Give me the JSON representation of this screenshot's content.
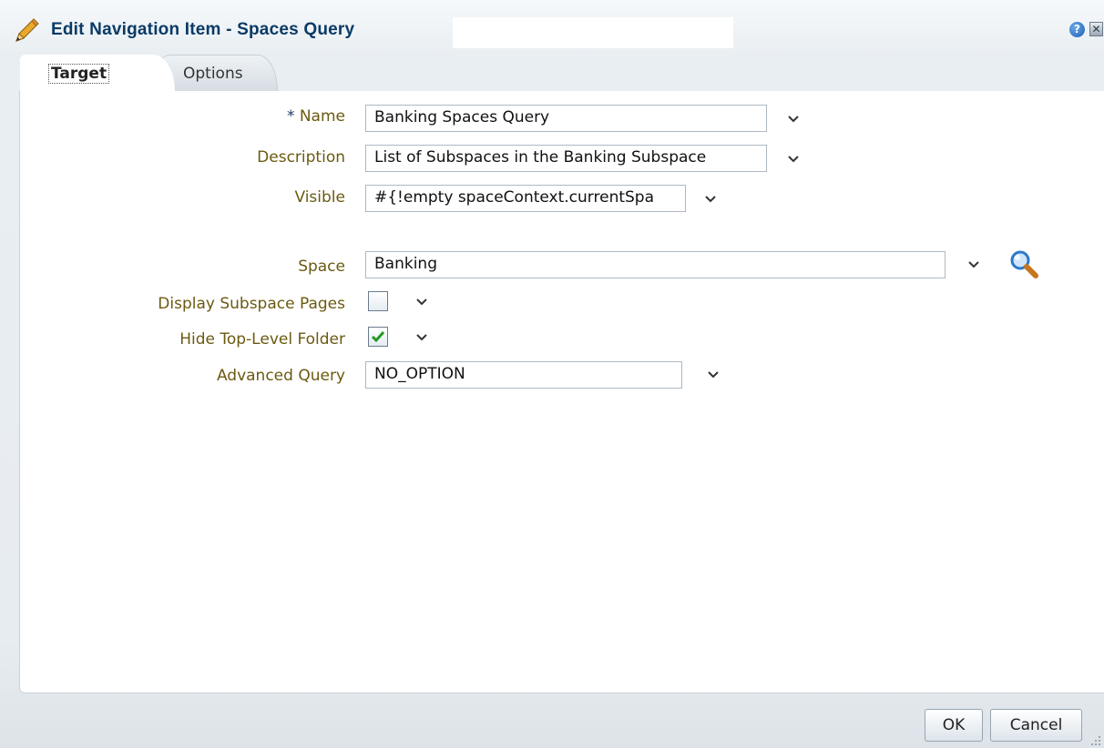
{
  "dialog": {
    "title": "Edit Navigation Item - Spaces Query",
    "help_glyph": "?",
    "close_glyph": "✕"
  },
  "tabs": [
    {
      "label": "Target",
      "selected": true
    },
    {
      "label": "Options",
      "selected": false
    }
  ],
  "form": {
    "name": {
      "required_mark": "*",
      "label": "Name",
      "value": "Banking Spaces Query"
    },
    "description": {
      "label": "Description",
      "value": "List of Subspaces in the Banking Subspace"
    },
    "visible": {
      "label": "Visible",
      "value": "#{!empty spaceContext.currentSpa"
    },
    "space": {
      "label": "Space",
      "value": "Banking"
    },
    "display_subspace_pages": {
      "label": "Display Subspace Pages",
      "checked": false
    },
    "hide_top_level_folder": {
      "label": "Hide Top-Level Folder",
      "checked": true
    },
    "advanced_query": {
      "label": "Advanced Query",
      "value": "NO_OPTION"
    }
  },
  "footer": {
    "ok_label": "OK",
    "cancel_label": "Cancel"
  },
  "colors": {
    "title": "#0a3a66",
    "label": "#6b5a11",
    "required_mark": "#1d3d67",
    "check_green": "#1f9a1f"
  },
  "icons": [
    "pencil-icon",
    "help-icon",
    "close-icon",
    "chevron-down-icon",
    "magnifier-icon",
    "checkmark-icon",
    "resize-grip-icon"
  ]
}
